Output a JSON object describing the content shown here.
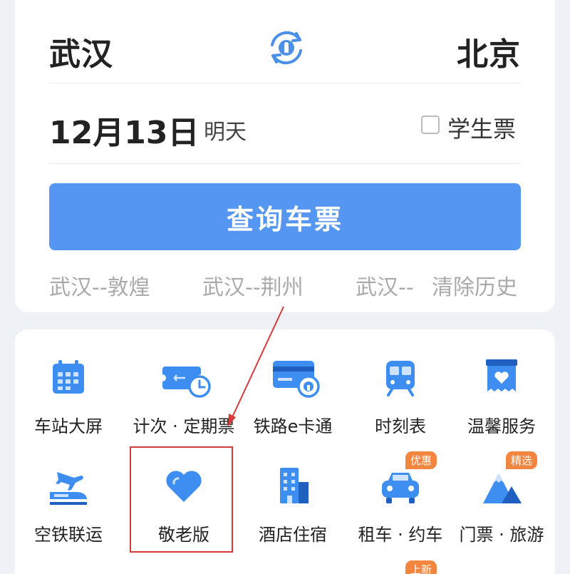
{
  "search": {
    "from_city": "武汉",
    "to_city": "北京",
    "date": "12月13日",
    "date_relative": "明天",
    "student_ticket_label": "学生票",
    "query_button": "查询车票",
    "history": [
      "武汉--敦煌",
      "武汉--荆州",
      "武汉--"
    ],
    "clear_history": "清除历史"
  },
  "services": {
    "row1": [
      {
        "label": "车站大屏",
        "icon": "calendar-icon"
      },
      {
        "label": "计次 · 定期票",
        "icon": "ticket-clock-icon"
      },
      {
        "label": "铁路e卡通",
        "icon": "rail-card-icon"
      },
      {
        "label": "时刻表",
        "icon": "train-icon"
      },
      {
        "label": "温馨服务",
        "icon": "heart-box-icon"
      }
    ],
    "row2": [
      {
        "label": "空铁联运",
        "icon": "plane-train-icon"
      },
      {
        "label": "敬老版",
        "icon": "heart-icon"
      },
      {
        "label": "酒店住宿",
        "icon": "hotel-icon"
      },
      {
        "label": "租车 · 约车",
        "icon": "car-icon",
        "badge": "优惠"
      },
      {
        "label": "门票 · 旅游",
        "icon": "mountain-icon",
        "badge": "精选"
      }
    ],
    "row3_badge": "上新"
  },
  "colors": {
    "primary": "#5596f2",
    "icon_blue": "#3d8ef0",
    "badge": "#f2853f",
    "highlight": "#d43c3c"
  }
}
